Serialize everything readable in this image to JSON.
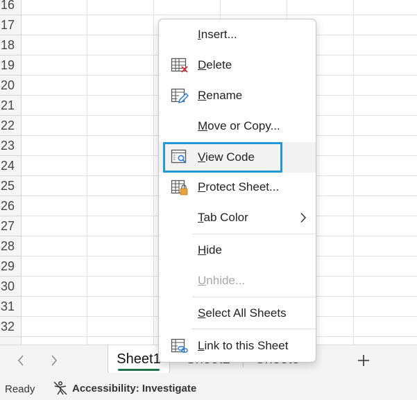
{
  "row_headers": [
    "16",
    "17",
    "18",
    "19",
    "20",
    "21",
    "22",
    "23",
    "24",
    "25",
    "26",
    "27",
    "28",
    "29",
    "30",
    "31",
    "32"
  ],
  "context_menu": {
    "items": [
      {
        "pre": "",
        "ul": "I",
        "post": "nsert...",
        "icon": "none"
      },
      {
        "pre": "",
        "ul": "D",
        "post": "elete",
        "icon": "delete-sheet-icon"
      },
      {
        "pre": "",
        "ul": "R",
        "post": "ename",
        "icon": "rename-sheet-icon"
      },
      {
        "pre": "",
        "ul": "M",
        "post": "ove or Copy...",
        "icon": "none"
      },
      {
        "pre": "",
        "ul": "V",
        "post": "iew Code",
        "icon": "view-code-icon"
      },
      {
        "pre": "",
        "ul": "P",
        "post": "rotect Sheet...",
        "icon": "protect-sheet-icon"
      },
      {
        "pre": "",
        "ul": "T",
        "post": "ab Color",
        "icon": "none"
      },
      {
        "pre": "",
        "ul": "H",
        "post": "ide",
        "icon": "none"
      },
      {
        "pre": "",
        "ul": "U",
        "post": "nhide...",
        "icon": "none"
      },
      {
        "pre": "",
        "ul": "S",
        "post": "elect All Sheets",
        "icon": "none"
      },
      {
        "pre": "",
        "ul": "L",
        "post": "ink to this Sheet",
        "icon": "link-sheet-icon"
      }
    ]
  },
  "tabs": [
    "Sheet1",
    "Sheet2",
    "Sheet3"
  ],
  "status": {
    "ready": "Ready",
    "accessibility": "Accessibility: Investigate"
  },
  "colors": {
    "accent_highlight": "#1f9ad6",
    "active_tab_underline": "#1e7145",
    "delete_x": "#d13438",
    "lock": "#e8a33d",
    "blue_icon": "#2b7cd3"
  }
}
